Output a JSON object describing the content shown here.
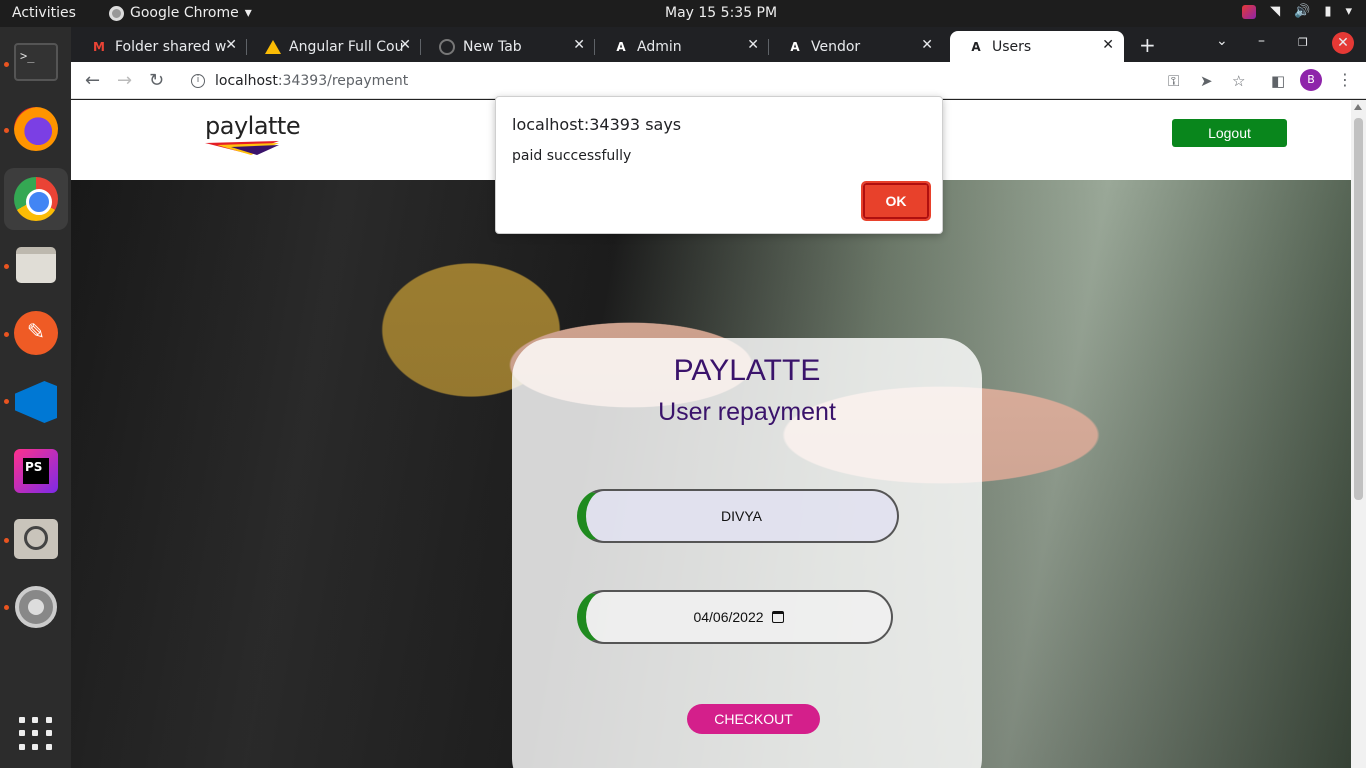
{
  "system": {
    "activities": "Activities",
    "app_menu": "Google Chrome",
    "clock": "May 15  5:35 PM"
  },
  "dock": {
    "items": [
      "terminal",
      "firefox",
      "google-chrome",
      "files",
      "postman",
      "vscode",
      "phpstorm",
      "image-viewer",
      "settings",
      "show-applications"
    ]
  },
  "browser": {
    "tabs": [
      {
        "title": "Folder shared w",
        "icon": "gmail-icon"
      },
      {
        "title": "Angular Full Cou",
        "icon": "google-drive-icon"
      },
      {
        "title": "New Tab",
        "icon": "globe-icon"
      },
      {
        "title": "Admin",
        "icon": "angular-icon"
      },
      {
        "title": "Vendor",
        "icon": "angular-icon"
      },
      {
        "title": "Users",
        "icon": "angular-icon",
        "active": true
      }
    ],
    "url_host": "localhost",
    "url_rest": ":34393/repayment",
    "profile_initial": "B"
  },
  "page": {
    "brand": "paylatte",
    "logout_label": "Logout",
    "card": {
      "title": "PAYLATTE",
      "subtitle": "User repayment",
      "name_value": "DIVYA",
      "date_value": "04/06/2022",
      "checkout_label": "CHECKOUT"
    }
  },
  "dialog": {
    "title": "localhost:34393 says",
    "message": "paid successfully",
    "ok_label": "OK"
  },
  "colors": {
    "logout": "#09861c",
    "checkout": "#d41f8b",
    "title": "#3a136b",
    "ok": "#e8412b"
  }
}
